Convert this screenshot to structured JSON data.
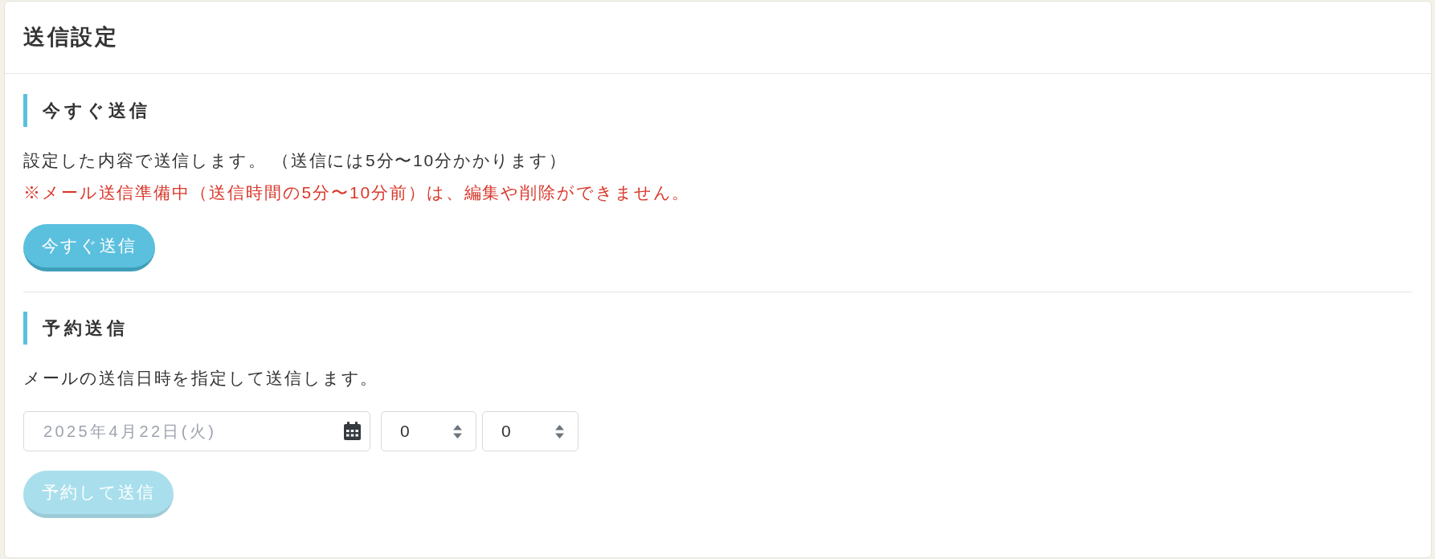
{
  "title": "送信設定",
  "sections": [
    {
      "kind": "send_now",
      "heading": "今すぐ送信",
      "description": "設定した内容で送信します。 （送信には5分〜10分かかります）",
      "notice": "※メール送信準備中（送信時間の5分〜10分前）は、編集や削除ができません。",
      "button": {
        "label": "今すぐ送信",
        "disabled": false
      }
    },
    {
      "kind": "scheduled",
      "heading": "予約送信",
      "description": "メールの送信日時を指定して送信します。",
      "date_field": {
        "placeholder": "2025年4月22日(火)"
      },
      "time_selects": [
        {
          "value": "0"
        },
        {
          "value": "0"
        }
      ],
      "button": {
        "label": "予約して送信",
        "disabled": true
      }
    }
  ]
}
